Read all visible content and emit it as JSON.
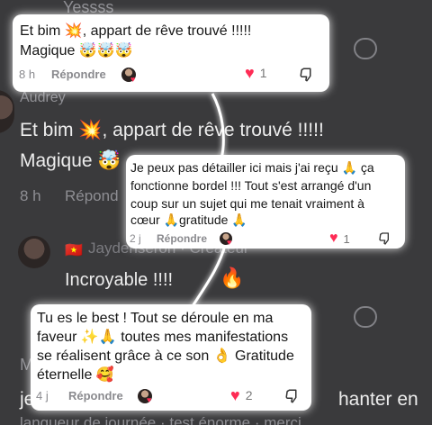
{
  "background": {
    "partial_top": "Yessss",
    "username_audrey": "Audrey",
    "audrey_line1": "Et bim 💥, appart de rêve trouvé !!!!!",
    "audrey_line2": "Magique 🤯",
    "audrey_time": "8 h",
    "audrey_reply": "Répond",
    "jayden_name": "Jaydenseron · Créateur",
    "jayden_flag": "🇻🇳",
    "jayden_text": "Incroyable !!!!",
    "jayden_emoji": "🔥",
    "fourth_initial": "M",
    "fourth_text_left": "je",
    "fourth_text_right": "hanter en",
    "bottom_text": "langueur de journée · test énorme · merci"
  },
  "comments": [
    {
      "line1": "Et bim 💥, appart de rêve trouvé !!!!!",
      "line2": "Magique 🤯🤯🤯",
      "time": "8 h",
      "reply_label": "Répondre",
      "likes": "1"
    },
    {
      "line1": "Je peux pas détailler ici mais j'ai reçu 🙏 ça",
      "line2": "fonctionne bordel !!! Tout s'est arrangé d'un",
      "line3": "coup sur un sujet qui me tenait vraiment à",
      "line4": "cœur 🙏gratitude 🙏",
      "time": "2 j",
      "reply_label": "Répondre",
      "likes": "1"
    },
    {
      "line1": "Tu es le best ! Tout se déroule en ma",
      "line2": "faveur ✨🙏 toutes mes manifestations",
      "line3": "se réalisent grâce à ce son 👌 Gratitude",
      "line4": "éternelle 🥰",
      "time": "4 j",
      "reply_label": "Répondre",
      "likes": "2"
    }
  ],
  "icons": {
    "heart_filled": "♥",
    "heart_outline": "heart-outline-icon",
    "dislike": "thumbs-down-icon",
    "creator_avatar": "creator-avatar"
  },
  "colors": {
    "like_red": "#fe2c55",
    "background": "#3a3a3c",
    "card": "#ffffff",
    "meta_gray": "#8a8a8e"
  }
}
